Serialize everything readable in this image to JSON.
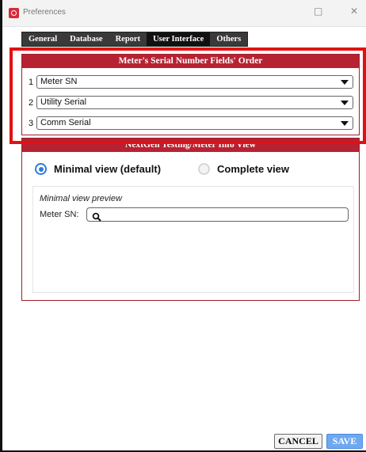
{
  "window": {
    "title": "Preferences",
    "controls": {
      "minimize": "—",
      "maximize": "□",
      "close": "✕"
    }
  },
  "tabs": [
    {
      "label": "General",
      "active": false
    },
    {
      "label": "Database",
      "active": false
    },
    {
      "label": "Report",
      "active": false
    },
    {
      "label": "User Interface",
      "active": true
    },
    {
      "label": "Others",
      "active": false
    }
  ],
  "serial_order": {
    "header": "Meter's Serial Number Fields' Order",
    "rows": [
      {
        "number": "1",
        "value": "Meter SN"
      },
      {
        "number": "2",
        "value": "Utility Serial"
      },
      {
        "number": "3",
        "value": "Comm Serial"
      }
    ]
  },
  "info_view": {
    "header": "NextGen Testing/Meter Info View",
    "options": [
      {
        "label": "Minimal view (default)",
        "selected": true
      },
      {
        "label": "Complete view",
        "selected": false
      }
    ],
    "preview": {
      "title": "Minimal view preview",
      "field_label": "Meter SN:",
      "field_value": ""
    }
  },
  "footer": {
    "cancel_label": "CANCEL",
    "save_label": "SAVE"
  },
  "colors": {
    "panel_header": "#b72233",
    "highlight": "#e11111",
    "radio_selected": "#2f7be0",
    "save_button": "#6ea8ef"
  }
}
